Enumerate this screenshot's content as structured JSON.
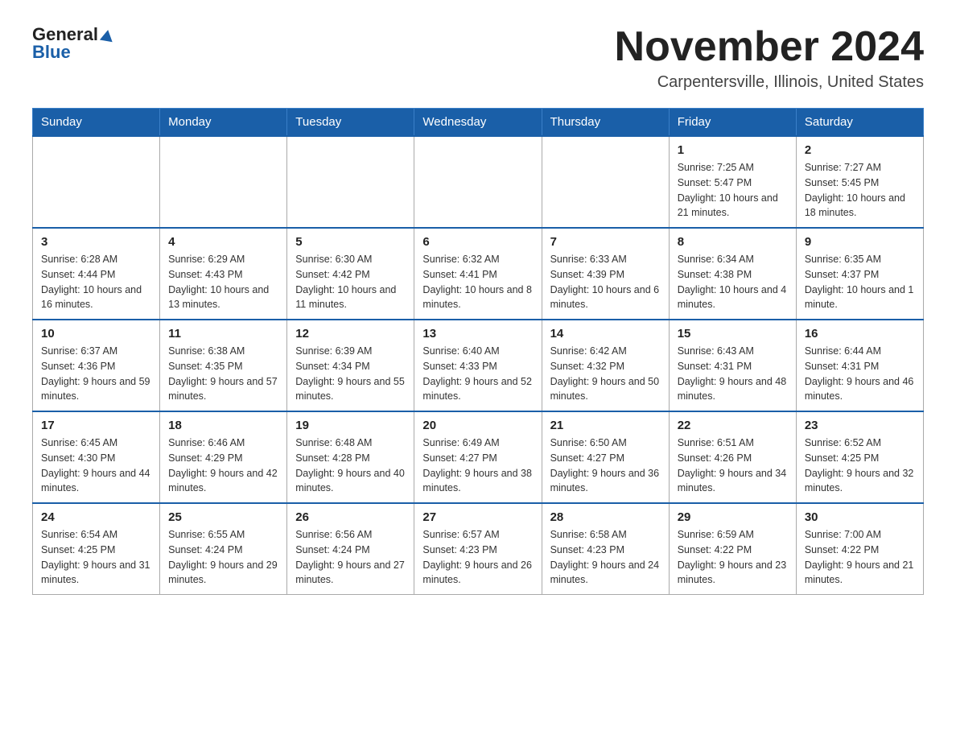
{
  "header": {
    "logo_general": "General",
    "logo_blue": "Blue",
    "title": "November 2024",
    "subtitle": "Carpentersville, Illinois, United States"
  },
  "weekdays": [
    "Sunday",
    "Monday",
    "Tuesday",
    "Wednesday",
    "Thursday",
    "Friday",
    "Saturday"
  ],
  "weeks": [
    [
      {
        "day": "",
        "info": ""
      },
      {
        "day": "",
        "info": ""
      },
      {
        "day": "",
        "info": ""
      },
      {
        "day": "",
        "info": ""
      },
      {
        "day": "",
        "info": ""
      },
      {
        "day": "1",
        "info": "Sunrise: 7:25 AM\nSunset: 5:47 PM\nDaylight: 10 hours and 21 minutes."
      },
      {
        "day": "2",
        "info": "Sunrise: 7:27 AM\nSunset: 5:45 PM\nDaylight: 10 hours and 18 minutes."
      }
    ],
    [
      {
        "day": "3",
        "info": "Sunrise: 6:28 AM\nSunset: 4:44 PM\nDaylight: 10 hours and 16 minutes."
      },
      {
        "day": "4",
        "info": "Sunrise: 6:29 AM\nSunset: 4:43 PM\nDaylight: 10 hours and 13 minutes."
      },
      {
        "day": "5",
        "info": "Sunrise: 6:30 AM\nSunset: 4:42 PM\nDaylight: 10 hours and 11 minutes."
      },
      {
        "day": "6",
        "info": "Sunrise: 6:32 AM\nSunset: 4:41 PM\nDaylight: 10 hours and 8 minutes."
      },
      {
        "day": "7",
        "info": "Sunrise: 6:33 AM\nSunset: 4:39 PM\nDaylight: 10 hours and 6 minutes."
      },
      {
        "day": "8",
        "info": "Sunrise: 6:34 AM\nSunset: 4:38 PM\nDaylight: 10 hours and 4 minutes."
      },
      {
        "day": "9",
        "info": "Sunrise: 6:35 AM\nSunset: 4:37 PM\nDaylight: 10 hours and 1 minute."
      }
    ],
    [
      {
        "day": "10",
        "info": "Sunrise: 6:37 AM\nSunset: 4:36 PM\nDaylight: 9 hours and 59 minutes."
      },
      {
        "day": "11",
        "info": "Sunrise: 6:38 AM\nSunset: 4:35 PM\nDaylight: 9 hours and 57 minutes."
      },
      {
        "day": "12",
        "info": "Sunrise: 6:39 AM\nSunset: 4:34 PM\nDaylight: 9 hours and 55 minutes."
      },
      {
        "day": "13",
        "info": "Sunrise: 6:40 AM\nSunset: 4:33 PM\nDaylight: 9 hours and 52 minutes."
      },
      {
        "day": "14",
        "info": "Sunrise: 6:42 AM\nSunset: 4:32 PM\nDaylight: 9 hours and 50 minutes."
      },
      {
        "day": "15",
        "info": "Sunrise: 6:43 AM\nSunset: 4:31 PM\nDaylight: 9 hours and 48 minutes."
      },
      {
        "day": "16",
        "info": "Sunrise: 6:44 AM\nSunset: 4:31 PM\nDaylight: 9 hours and 46 minutes."
      }
    ],
    [
      {
        "day": "17",
        "info": "Sunrise: 6:45 AM\nSunset: 4:30 PM\nDaylight: 9 hours and 44 minutes."
      },
      {
        "day": "18",
        "info": "Sunrise: 6:46 AM\nSunset: 4:29 PM\nDaylight: 9 hours and 42 minutes."
      },
      {
        "day": "19",
        "info": "Sunrise: 6:48 AM\nSunset: 4:28 PM\nDaylight: 9 hours and 40 minutes."
      },
      {
        "day": "20",
        "info": "Sunrise: 6:49 AM\nSunset: 4:27 PM\nDaylight: 9 hours and 38 minutes."
      },
      {
        "day": "21",
        "info": "Sunrise: 6:50 AM\nSunset: 4:27 PM\nDaylight: 9 hours and 36 minutes."
      },
      {
        "day": "22",
        "info": "Sunrise: 6:51 AM\nSunset: 4:26 PM\nDaylight: 9 hours and 34 minutes."
      },
      {
        "day": "23",
        "info": "Sunrise: 6:52 AM\nSunset: 4:25 PM\nDaylight: 9 hours and 32 minutes."
      }
    ],
    [
      {
        "day": "24",
        "info": "Sunrise: 6:54 AM\nSunset: 4:25 PM\nDaylight: 9 hours and 31 minutes."
      },
      {
        "day": "25",
        "info": "Sunrise: 6:55 AM\nSunset: 4:24 PM\nDaylight: 9 hours and 29 minutes."
      },
      {
        "day": "26",
        "info": "Sunrise: 6:56 AM\nSunset: 4:24 PM\nDaylight: 9 hours and 27 minutes."
      },
      {
        "day": "27",
        "info": "Sunrise: 6:57 AM\nSunset: 4:23 PM\nDaylight: 9 hours and 26 minutes."
      },
      {
        "day": "28",
        "info": "Sunrise: 6:58 AM\nSunset: 4:23 PM\nDaylight: 9 hours and 24 minutes."
      },
      {
        "day": "29",
        "info": "Sunrise: 6:59 AM\nSunset: 4:22 PM\nDaylight: 9 hours and 23 minutes."
      },
      {
        "day": "30",
        "info": "Sunrise: 7:00 AM\nSunset: 4:22 PM\nDaylight: 9 hours and 21 minutes."
      }
    ]
  ]
}
